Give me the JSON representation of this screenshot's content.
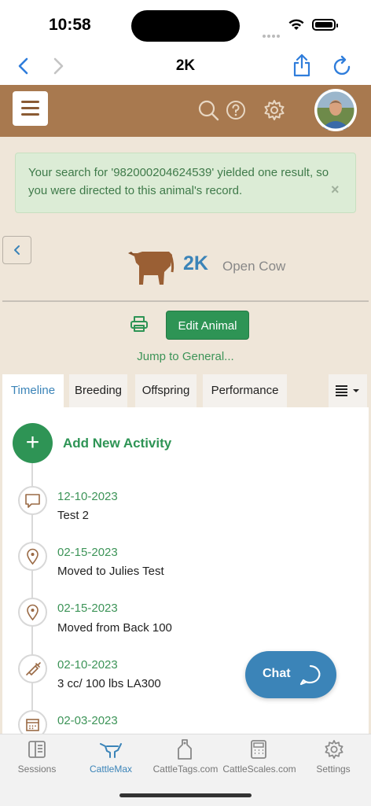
{
  "status_bar": {
    "time": "10:58"
  },
  "browser": {
    "title": "2K"
  },
  "alert": {
    "text": "Your search for '982000204624539' yielded one result, so you were directed to this animal's record.",
    "close": "×"
  },
  "animal": {
    "id": "2K",
    "type": "Open Cow",
    "edit_label": "Edit Animal",
    "jump_label": "Jump to General..."
  },
  "tabs": [
    {
      "label": "Timeline",
      "active": true
    },
    {
      "label": "Breeding"
    },
    {
      "label": "Offspring"
    },
    {
      "label": "Performance"
    }
  ],
  "timeline": {
    "add_label": "Add New Activity",
    "activities": [
      {
        "date": "12-10-2023",
        "desc": "Test 2",
        "icon": "comment-icon"
      },
      {
        "date": "02-15-2023",
        "desc": "Moved to Julies Test",
        "icon": "location-pin-icon"
      },
      {
        "date": "02-15-2023",
        "desc": "Moved from Back 100",
        "icon": "location-pin-icon"
      },
      {
        "date": "02-10-2023",
        "desc": "3 cc/ 100 lbs LA300",
        "icon": "syringe-icon"
      },
      {
        "date": "02-03-2023",
        "desc": "",
        "icon": "calendar-icon"
      }
    ]
  },
  "chat": {
    "label": "Chat"
  },
  "bottom_tabs": [
    {
      "label": "Sessions",
      "icon": "sessions-icon"
    },
    {
      "label": "CattleMax",
      "icon": "cattlemax-icon",
      "active": true
    },
    {
      "label": "CattleTags.com",
      "icon": "tag-icon"
    },
    {
      "label": "CattleScales.com",
      "icon": "scale-icon"
    },
    {
      "label": "Settings",
      "icon": "gear-icon"
    }
  ],
  "colors": {
    "header_brown": "#a8794f",
    "page_bg": "#efe6d9",
    "green": "#2e9455",
    "blue": "#3b84b8"
  }
}
